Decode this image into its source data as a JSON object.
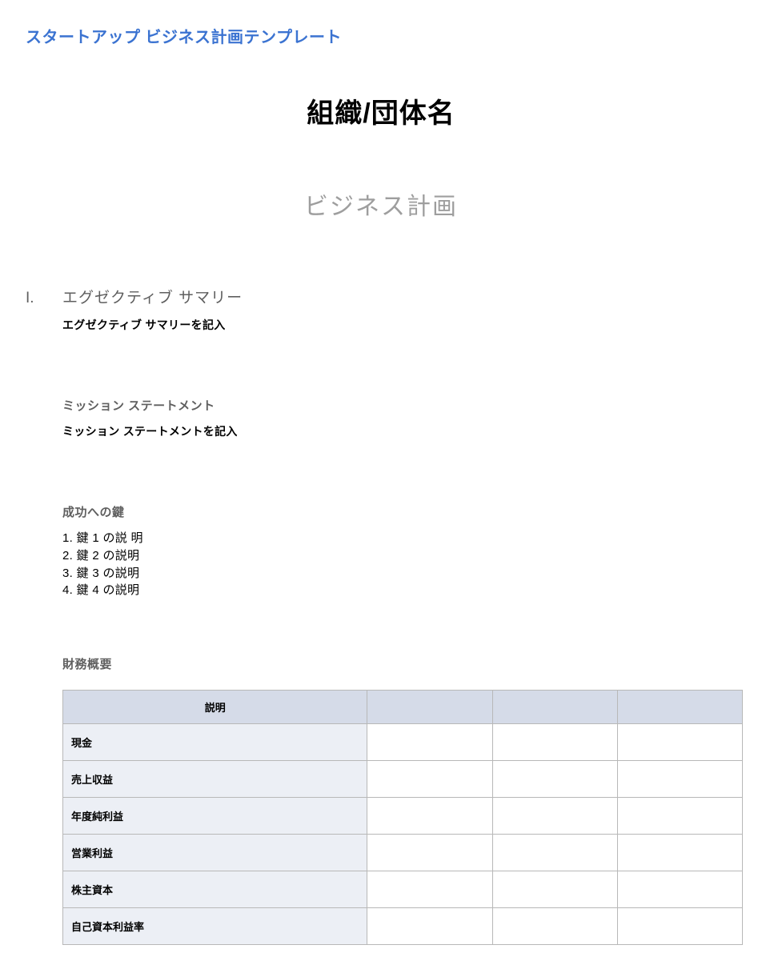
{
  "template_title": "スタートアップ ビジネス計画テンプレート",
  "org_name": "組織/団体名",
  "biz_plan_label": "ビジネス計画",
  "section1": {
    "number": "I.",
    "heading": "エグゼクティブ サマリー",
    "placeholder": "エグゼクティブ サマリーを記入"
  },
  "mission": {
    "heading": "ミッション ステートメント",
    "placeholder": "ミッション ステートメントを記入"
  },
  "keys": {
    "heading": "成功への鍵",
    "items": [
      "1. 鍵 1 の説 明",
      "2. 鍵 2 の説明",
      "3. 鍵 3 の説明",
      "4. 鍵 4 の説明"
    ]
  },
  "finance": {
    "heading": "財務概要",
    "header_desc": "説明",
    "header_col1": "",
    "header_col2": "",
    "header_col3": "",
    "rows": [
      {
        "label": "現金",
        "c1": "",
        "c2": "",
        "c3": ""
      },
      {
        "label": "売上収益",
        "c1": "",
        "c2": "",
        "c3": ""
      },
      {
        "label": "年度純利益",
        "c1": "",
        "c2": "",
        "c3": ""
      },
      {
        "label": "営業利益",
        "c1": "",
        "c2": "",
        "c3": ""
      },
      {
        "label": "株主資本",
        "c1": "",
        "c2": "",
        "c3": ""
      },
      {
        "label": "自己資本利益率",
        "c1": "",
        "c2": "",
        "c3": ""
      }
    ]
  }
}
